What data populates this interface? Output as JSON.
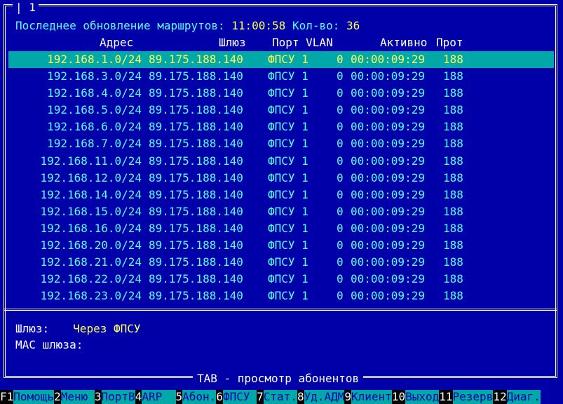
{
  "window": {
    "tab": "1"
  },
  "header": {
    "update_label": "Последнее обновление маршрутов: ",
    "update_time": "11:00:58",
    "count_label": " Кол-во: ",
    "count": "36"
  },
  "columns": {
    "addr": "Адрес",
    "gw": "Шлюз",
    "port_vlan": "Порт VLAN",
    "active": "Активно",
    "prot": "Прот"
  },
  "routes": [
    {
      "addr": "192.168.1.0/24",
      "gw": "89.175.188.140",
      "port": "ФПСУ 1",
      "vlan": "0",
      "active": "00:00:09:29",
      "prot": "188"
    },
    {
      "addr": "192.168.3.0/24",
      "gw": "89.175.188.140",
      "port": "ФПСУ 1",
      "vlan": "0",
      "active": "00:00:09:29",
      "prot": "188"
    },
    {
      "addr": "192.168.4.0/24",
      "gw": "89.175.188.140",
      "port": "ФПСУ 1",
      "vlan": "0",
      "active": "00:00:09:29",
      "prot": "188"
    },
    {
      "addr": "192.168.5.0/24",
      "gw": "89.175.188.140",
      "port": "ФПСУ 1",
      "vlan": "0",
      "active": "00:00:09:29",
      "prot": "188"
    },
    {
      "addr": "192.168.6.0/24",
      "gw": "89.175.188.140",
      "port": "ФПСУ 1",
      "vlan": "0",
      "active": "00:00:09:29",
      "prot": "188"
    },
    {
      "addr": "192.168.7.0/24",
      "gw": "89.175.188.140",
      "port": "ФПСУ 1",
      "vlan": "0",
      "active": "00:00:09:29",
      "prot": "188"
    },
    {
      "addr": "192.168.11.0/24",
      "gw": "89.175.188.140",
      "port": "ФПСУ 1",
      "vlan": "0",
      "active": "00:00:09:29",
      "prot": "188"
    },
    {
      "addr": "192.168.12.0/24",
      "gw": "89.175.188.140",
      "port": "ФПСУ 1",
      "vlan": "0",
      "active": "00:00:09:29",
      "prot": "188"
    },
    {
      "addr": "192.168.14.0/24",
      "gw": "89.175.188.140",
      "port": "ФПСУ 1",
      "vlan": "0",
      "active": "00:00:09:29",
      "prot": "188"
    },
    {
      "addr": "192.168.15.0/24",
      "gw": "89.175.188.140",
      "port": "ФПСУ 1",
      "vlan": "0",
      "active": "00:00:09:29",
      "prot": "188"
    },
    {
      "addr": "192.168.16.0/24",
      "gw": "89.175.188.140",
      "port": "ФПСУ 1",
      "vlan": "0",
      "active": "00:00:09:29",
      "prot": "188"
    },
    {
      "addr": "192.168.20.0/24",
      "gw": "89.175.188.140",
      "port": "ФПСУ 1",
      "vlan": "0",
      "active": "00:00:09:29",
      "prot": "188"
    },
    {
      "addr": "192.168.21.0/24",
      "gw": "89.175.188.140",
      "port": "ФПСУ 1",
      "vlan": "0",
      "active": "00:00:09:29",
      "prot": "188"
    },
    {
      "addr": "192.168.22.0/24",
      "gw": "89.175.188.140",
      "port": "ФПСУ 1",
      "vlan": "0",
      "active": "00:00:09:29",
      "prot": "188"
    },
    {
      "addr": "192.168.23.0/24",
      "gw": "89.175.188.140",
      "port": "ФПСУ 1",
      "vlan": "0",
      "active": "00:00:09:29",
      "prot": "188"
    }
  ],
  "details": {
    "gw_label": "Шлюз:",
    "gw_value": "Через ФПСУ",
    "mac_label": "MAC шлюза:"
  },
  "footer_title": "TAB - просмотр абонентов",
  "fkeys": [
    {
      "num": "F1",
      "label": "Помощь"
    },
    {
      "num": "2",
      "label": "Меню "
    },
    {
      "num": "3",
      "label": "ПортВ"
    },
    {
      "num": "4",
      "label": "ARP  "
    },
    {
      "num": "5",
      "label": "Абон."
    },
    {
      "num": "6",
      "label": "ФПСУ "
    },
    {
      "num": "7",
      "label": "Стат."
    },
    {
      "num": "8",
      "label": "Уд.АДМ"
    },
    {
      "num": "9",
      "label": "Клиент"
    },
    {
      "num": "10",
      "label": "Выход"
    },
    {
      "num": "11",
      "label": "Резерв"
    },
    {
      "num": "12",
      "label": "Диаг."
    }
  ],
  "colors": {
    "background": "#0000a8",
    "text": "#57ffff",
    "highlight_bg": "#00a8a8",
    "highlight_text": "#ffff57",
    "frame": "#ffffff"
  }
}
